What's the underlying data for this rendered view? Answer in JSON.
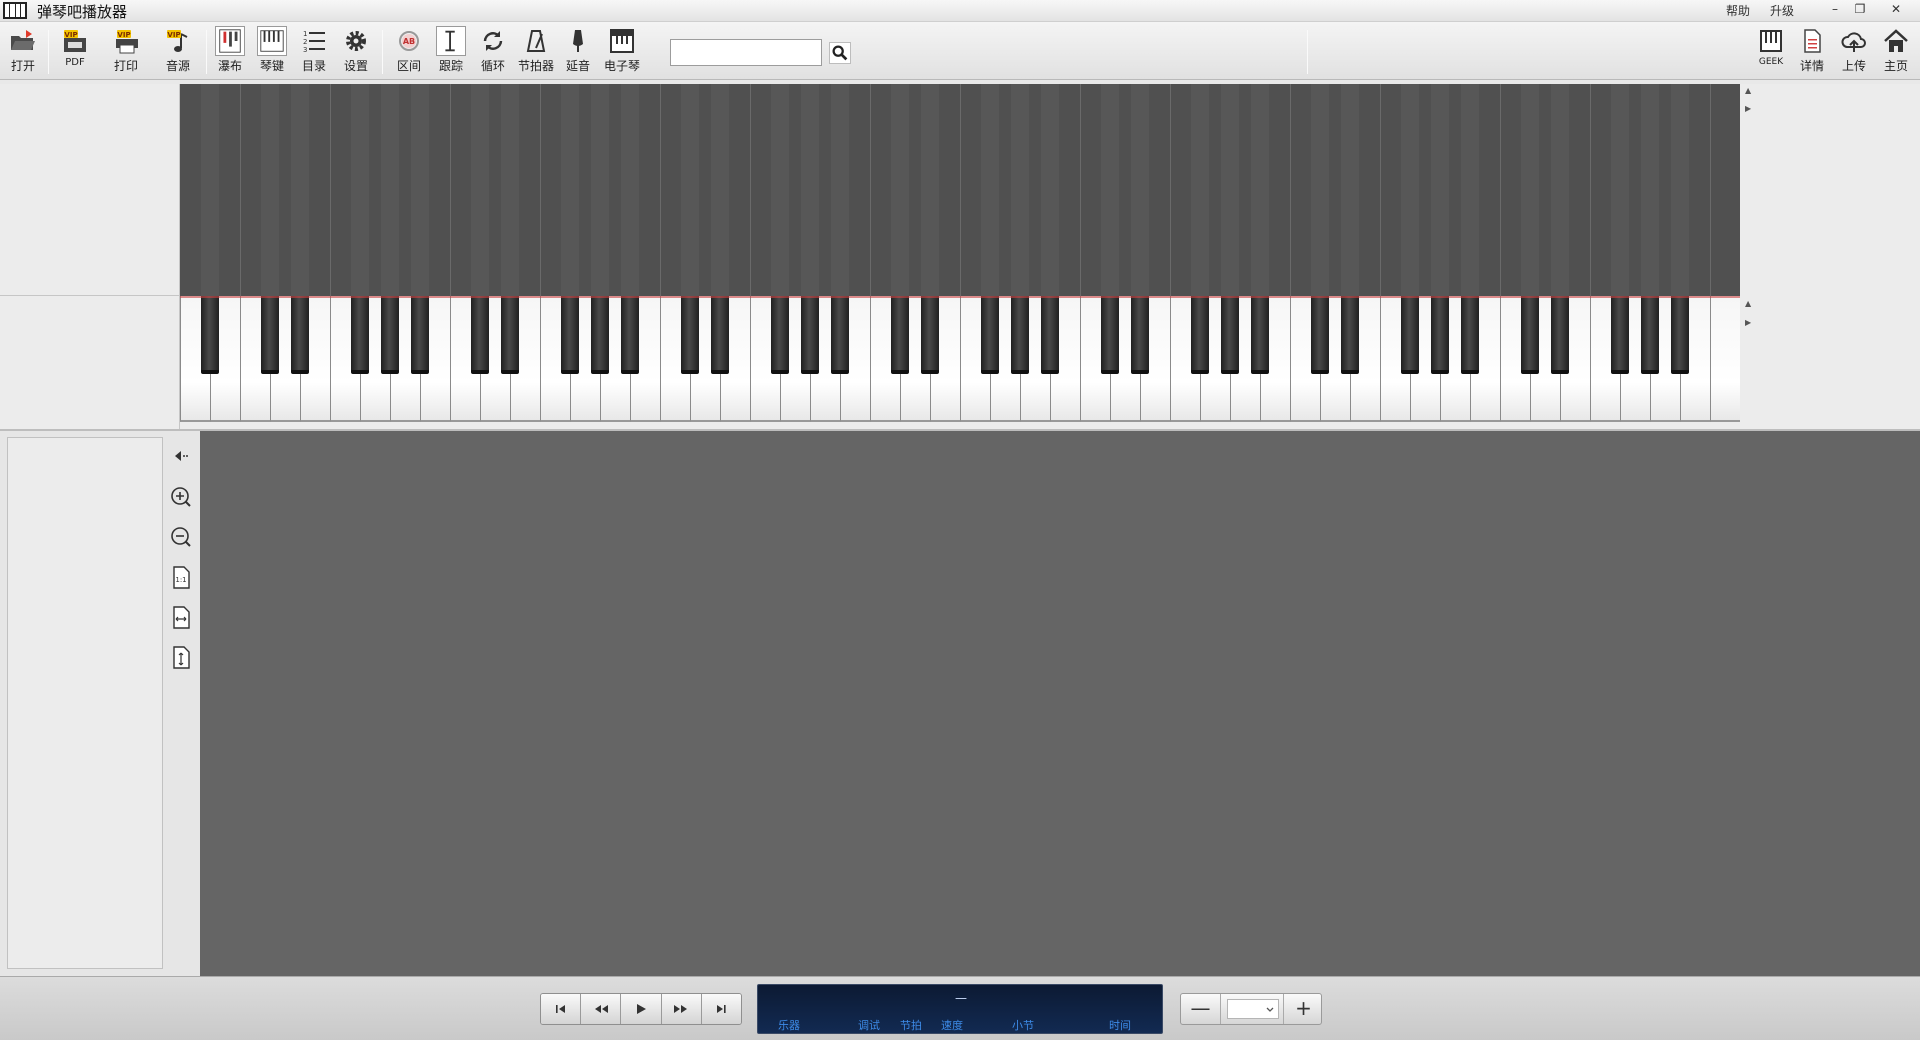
{
  "app": {
    "title": "弹琴吧播放器"
  },
  "titlebar": {
    "help": "帮助",
    "upgrade": "升级",
    "minimize": "–",
    "restore": "❐",
    "close": "✕"
  },
  "toolbar": {
    "left": [
      {
        "id": "open",
        "label": "打开",
        "icon": "folder-open-icon"
      },
      {
        "id": "pdf",
        "label": "PDF",
        "icon": "vip-pdf-icon",
        "badge": "VIP"
      },
      {
        "id": "print",
        "label": "打印",
        "icon": "vip-print-icon",
        "badge": "VIP"
      },
      {
        "id": "sound",
        "label": "音源",
        "icon": "vip-music-note-icon",
        "badge": "VIP"
      },
      {
        "id": "waterfall",
        "label": "瀑布",
        "icon": "waterfall-icon"
      },
      {
        "id": "keys",
        "label": "琴键",
        "icon": "piano-keys-icon"
      },
      {
        "id": "catalog",
        "label": "目录",
        "icon": "list-icon"
      },
      {
        "id": "settings",
        "label": "设置",
        "icon": "gear-icon"
      },
      {
        "id": "range",
        "label": "区间",
        "icon": "ab-loop-icon"
      },
      {
        "id": "track",
        "label": "跟踪",
        "icon": "cursor-track-icon"
      },
      {
        "id": "loop",
        "label": "循环",
        "icon": "loop-icon"
      },
      {
        "id": "metronome",
        "label": "节拍器",
        "icon": "metronome-icon"
      },
      {
        "id": "sustain",
        "label": "延音",
        "icon": "sustain-pedal-icon"
      },
      {
        "id": "epiano",
        "label": "电子琴",
        "icon": "electronic-keyboard-icon"
      }
    ],
    "search_value": "",
    "right": [
      {
        "id": "geek",
        "label": "GEEK",
        "icon": "geek-piano-icon"
      },
      {
        "id": "details",
        "label": "详情",
        "icon": "document-icon"
      },
      {
        "id": "upload",
        "label": "上传",
        "icon": "cloud-upload-icon"
      },
      {
        "id": "home",
        "label": "主页",
        "icon": "home-icon"
      }
    ]
  },
  "player": {
    "lcd_value": "—",
    "labels": [
      "乐器",
      "调试",
      "节拍",
      "速度",
      "小节",
      "时间"
    ]
  },
  "zoom": {
    "minus": "—",
    "plus": "+",
    "value": ""
  },
  "colors": {
    "waterfall_bg": "#505050",
    "score_bg": "#656565",
    "lcd_bg": "#0c1a33",
    "lcd_label": "#3d8be8"
  }
}
